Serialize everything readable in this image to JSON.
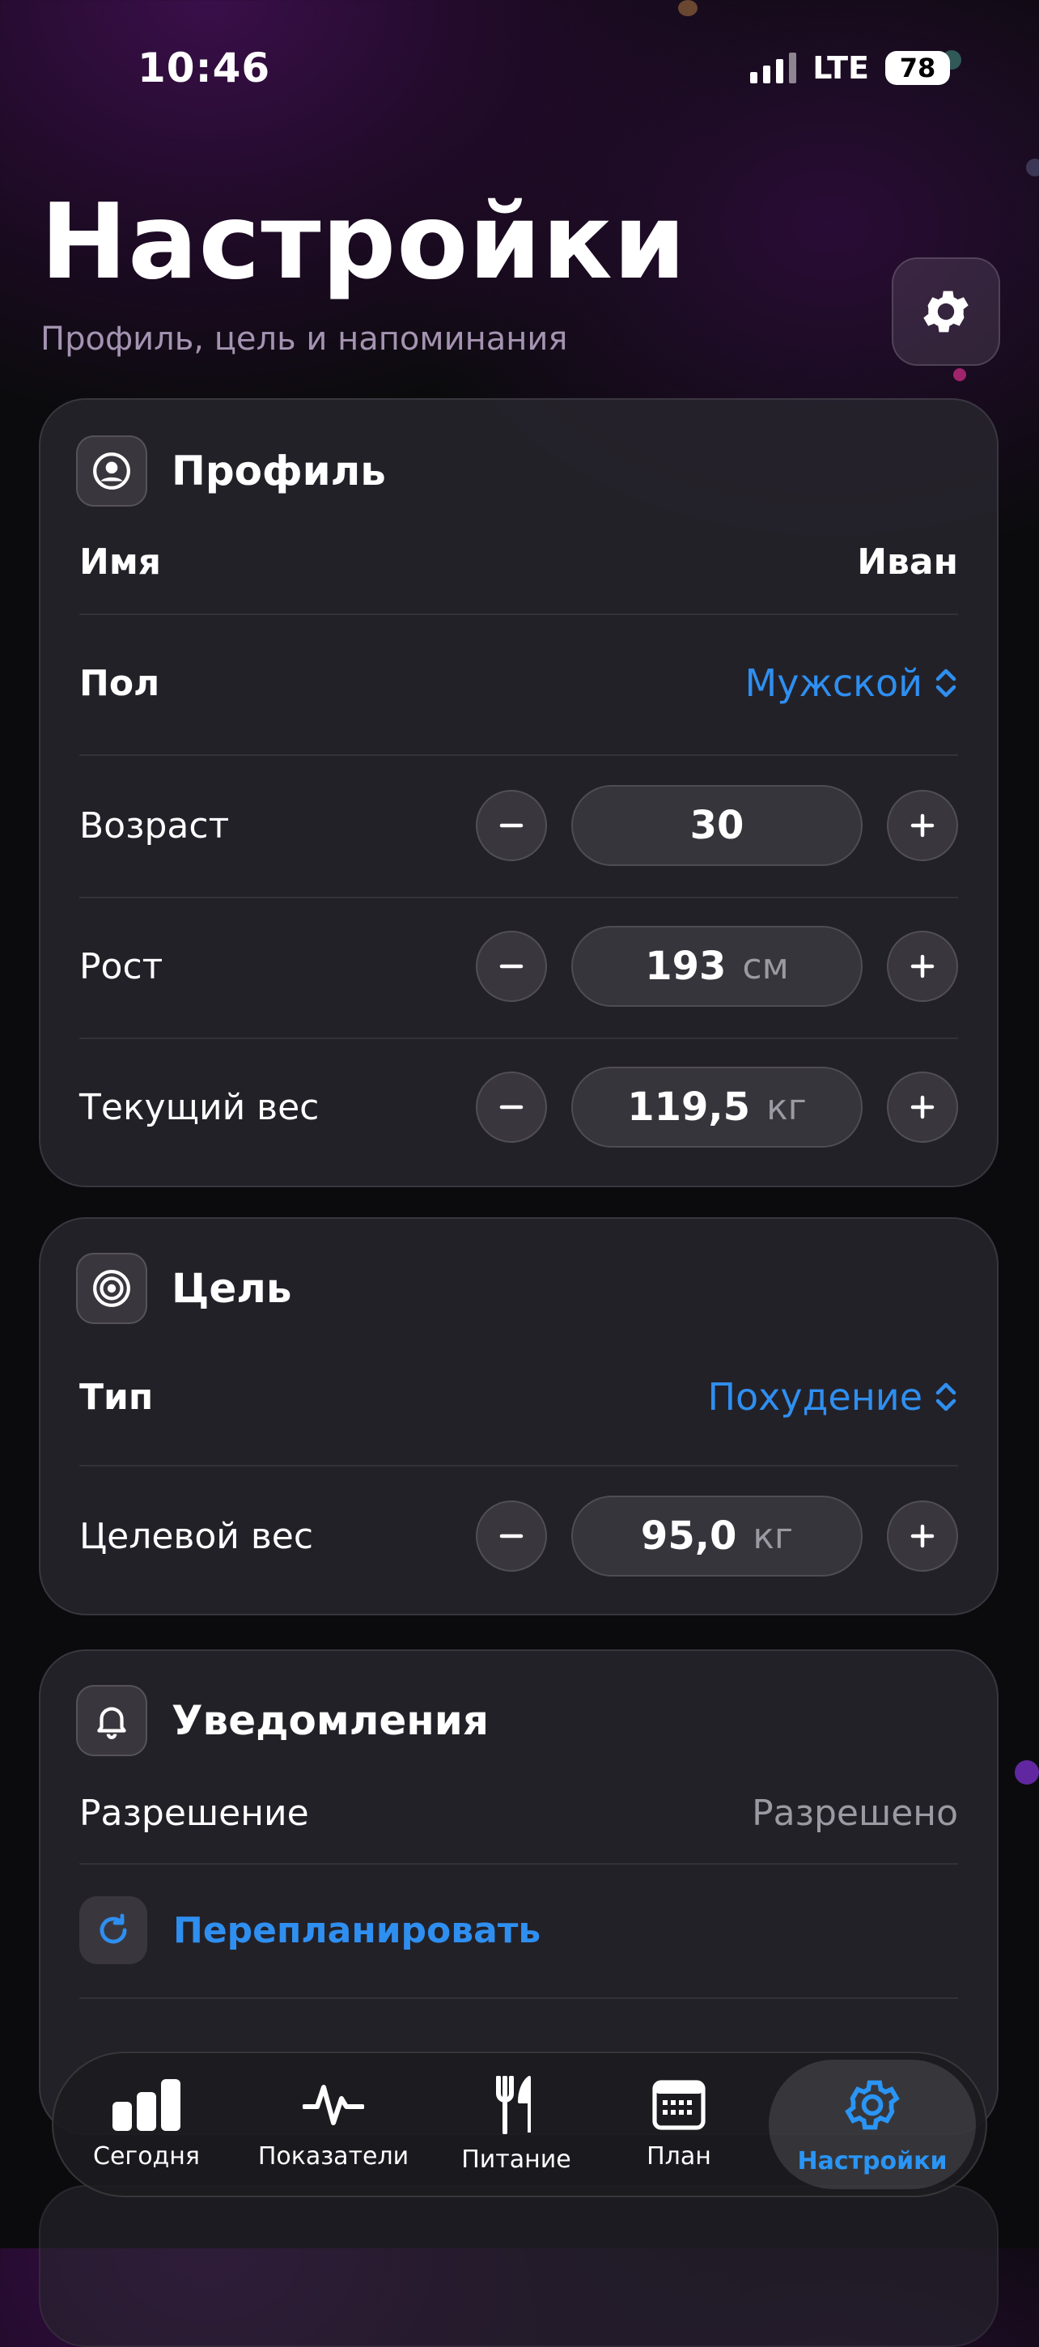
{
  "status": {
    "time": "10:46",
    "network": "LTE",
    "battery": "78"
  },
  "header": {
    "title": "Настройки",
    "subtitle": "Профиль, цель и напоминания",
    "settings_icon": "gear-icon"
  },
  "profile": {
    "title": "Профиль",
    "icon": "person-circle-icon",
    "name": {
      "label": "Имя",
      "value": "Иван"
    },
    "sex": {
      "label": "Пол",
      "value": "Мужской"
    },
    "age": {
      "label": "Возраст",
      "value": "30"
    },
    "height": {
      "label": "Рост",
      "value": "193",
      "unit": "см"
    },
    "weight": {
      "label": "Текущий вес",
      "value": "119,5",
      "unit": "кг"
    }
  },
  "goal": {
    "title": "Цель",
    "icon": "target-icon",
    "type": {
      "label": "Тип",
      "value": "Похудение"
    },
    "target_weight": {
      "label": "Целевой вес",
      "value": "95,0",
      "unit": "кг"
    }
  },
  "notifications": {
    "title": "Уведомления",
    "icon": "bell-icon",
    "permission": {
      "label": "Разрешение",
      "value": "Разрешено"
    },
    "reschedule": {
      "label": "Перепланировать",
      "icon": "refresh-icon"
    }
  },
  "tabs": [
    {
      "label": "Сегодня",
      "icon": "bar-chart-icon",
      "active": false
    },
    {
      "label": "Показатели",
      "icon": "pulse-icon",
      "active": false
    },
    {
      "label": "Питание",
      "icon": "fork-knife-icon",
      "active": false
    },
    {
      "label": "План",
      "icon": "calendar-icon",
      "active": false
    },
    {
      "label": "Настройки",
      "icon": "gear-icon",
      "active": true
    }
  ],
  "colors": {
    "accent": "#2f8ff0",
    "active_tab": "#2a95f5",
    "background": "#0b0b0d"
  }
}
